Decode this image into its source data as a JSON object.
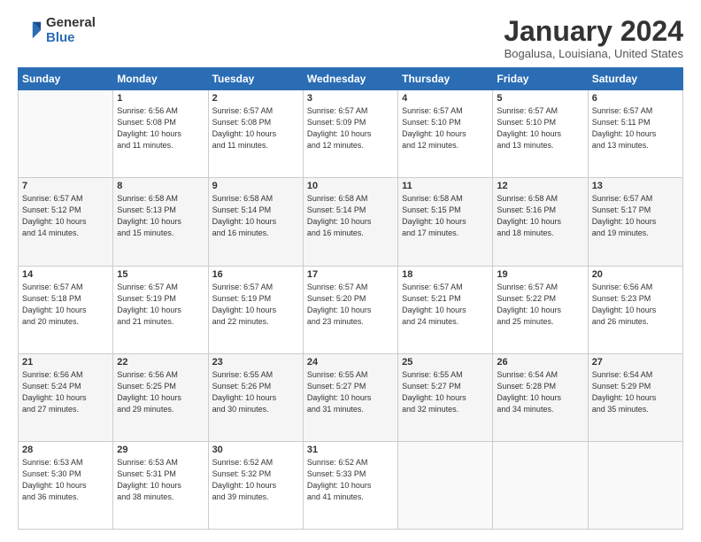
{
  "logo": {
    "general": "General",
    "blue": "Blue"
  },
  "title": "January 2024",
  "location": "Bogalusa, Louisiana, United States",
  "weekdays": [
    "Sunday",
    "Monday",
    "Tuesday",
    "Wednesday",
    "Thursday",
    "Friday",
    "Saturday"
  ],
  "weeks": [
    [
      {
        "day": "",
        "info": ""
      },
      {
        "day": "1",
        "info": "Sunrise: 6:56 AM\nSunset: 5:08 PM\nDaylight: 10 hours\nand 11 minutes."
      },
      {
        "day": "2",
        "info": "Sunrise: 6:57 AM\nSunset: 5:08 PM\nDaylight: 10 hours\nand 11 minutes."
      },
      {
        "day": "3",
        "info": "Sunrise: 6:57 AM\nSunset: 5:09 PM\nDaylight: 10 hours\nand 12 minutes."
      },
      {
        "day": "4",
        "info": "Sunrise: 6:57 AM\nSunset: 5:10 PM\nDaylight: 10 hours\nand 12 minutes."
      },
      {
        "day": "5",
        "info": "Sunrise: 6:57 AM\nSunset: 5:10 PM\nDaylight: 10 hours\nand 13 minutes."
      },
      {
        "day": "6",
        "info": "Sunrise: 6:57 AM\nSunset: 5:11 PM\nDaylight: 10 hours\nand 13 minutes."
      }
    ],
    [
      {
        "day": "7",
        "info": "Sunrise: 6:57 AM\nSunset: 5:12 PM\nDaylight: 10 hours\nand 14 minutes."
      },
      {
        "day": "8",
        "info": "Sunrise: 6:58 AM\nSunset: 5:13 PM\nDaylight: 10 hours\nand 15 minutes."
      },
      {
        "day": "9",
        "info": "Sunrise: 6:58 AM\nSunset: 5:14 PM\nDaylight: 10 hours\nand 16 minutes."
      },
      {
        "day": "10",
        "info": "Sunrise: 6:58 AM\nSunset: 5:14 PM\nDaylight: 10 hours\nand 16 minutes."
      },
      {
        "day": "11",
        "info": "Sunrise: 6:58 AM\nSunset: 5:15 PM\nDaylight: 10 hours\nand 17 minutes."
      },
      {
        "day": "12",
        "info": "Sunrise: 6:58 AM\nSunset: 5:16 PM\nDaylight: 10 hours\nand 18 minutes."
      },
      {
        "day": "13",
        "info": "Sunrise: 6:57 AM\nSunset: 5:17 PM\nDaylight: 10 hours\nand 19 minutes."
      }
    ],
    [
      {
        "day": "14",
        "info": "Sunrise: 6:57 AM\nSunset: 5:18 PM\nDaylight: 10 hours\nand 20 minutes."
      },
      {
        "day": "15",
        "info": "Sunrise: 6:57 AM\nSunset: 5:19 PM\nDaylight: 10 hours\nand 21 minutes."
      },
      {
        "day": "16",
        "info": "Sunrise: 6:57 AM\nSunset: 5:19 PM\nDaylight: 10 hours\nand 22 minutes."
      },
      {
        "day": "17",
        "info": "Sunrise: 6:57 AM\nSunset: 5:20 PM\nDaylight: 10 hours\nand 23 minutes."
      },
      {
        "day": "18",
        "info": "Sunrise: 6:57 AM\nSunset: 5:21 PM\nDaylight: 10 hours\nand 24 minutes."
      },
      {
        "day": "19",
        "info": "Sunrise: 6:57 AM\nSunset: 5:22 PM\nDaylight: 10 hours\nand 25 minutes."
      },
      {
        "day": "20",
        "info": "Sunrise: 6:56 AM\nSunset: 5:23 PM\nDaylight: 10 hours\nand 26 minutes."
      }
    ],
    [
      {
        "day": "21",
        "info": "Sunrise: 6:56 AM\nSunset: 5:24 PM\nDaylight: 10 hours\nand 27 minutes."
      },
      {
        "day": "22",
        "info": "Sunrise: 6:56 AM\nSunset: 5:25 PM\nDaylight: 10 hours\nand 29 minutes."
      },
      {
        "day": "23",
        "info": "Sunrise: 6:55 AM\nSunset: 5:26 PM\nDaylight: 10 hours\nand 30 minutes."
      },
      {
        "day": "24",
        "info": "Sunrise: 6:55 AM\nSunset: 5:27 PM\nDaylight: 10 hours\nand 31 minutes."
      },
      {
        "day": "25",
        "info": "Sunrise: 6:55 AM\nSunset: 5:27 PM\nDaylight: 10 hours\nand 32 minutes."
      },
      {
        "day": "26",
        "info": "Sunrise: 6:54 AM\nSunset: 5:28 PM\nDaylight: 10 hours\nand 34 minutes."
      },
      {
        "day": "27",
        "info": "Sunrise: 6:54 AM\nSunset: 5:29 PM\nDaylight: 10 hours\nand 35 minutes."
      }
    ],
    [
      {
        "day": "28",
        "info": "Sunrise: 6:53 AM\nSunset: 5:30 PM\nDaylight: 10 hours\nand 36 minutes."
      },
      {
        "day": "29",
        "info": "Sunrise: 6:53 AM\nSunset: 5:31 PM\nDaylight: 10 hours\nand 38 minutes."
      },
      {
        "day": "30",
        "info": "Sunrise: 6:52 AM\nSunset: 5:32 PM\nDaylight: 10 hours\nand 39 minutes."
      },
      {
        "day": "31",
        "info": "Sunrise: 6:52 AM\nSunset: 5:33 PM\nDaylight: 10 hours\nand 41 minutes."
      },
      {
        "day": "",
        "info": ""
      },
      {
        "day": "",
        "info": ""
      },
      {
        "day": "",
        "info": ""
      }
    ]
  ]
}
